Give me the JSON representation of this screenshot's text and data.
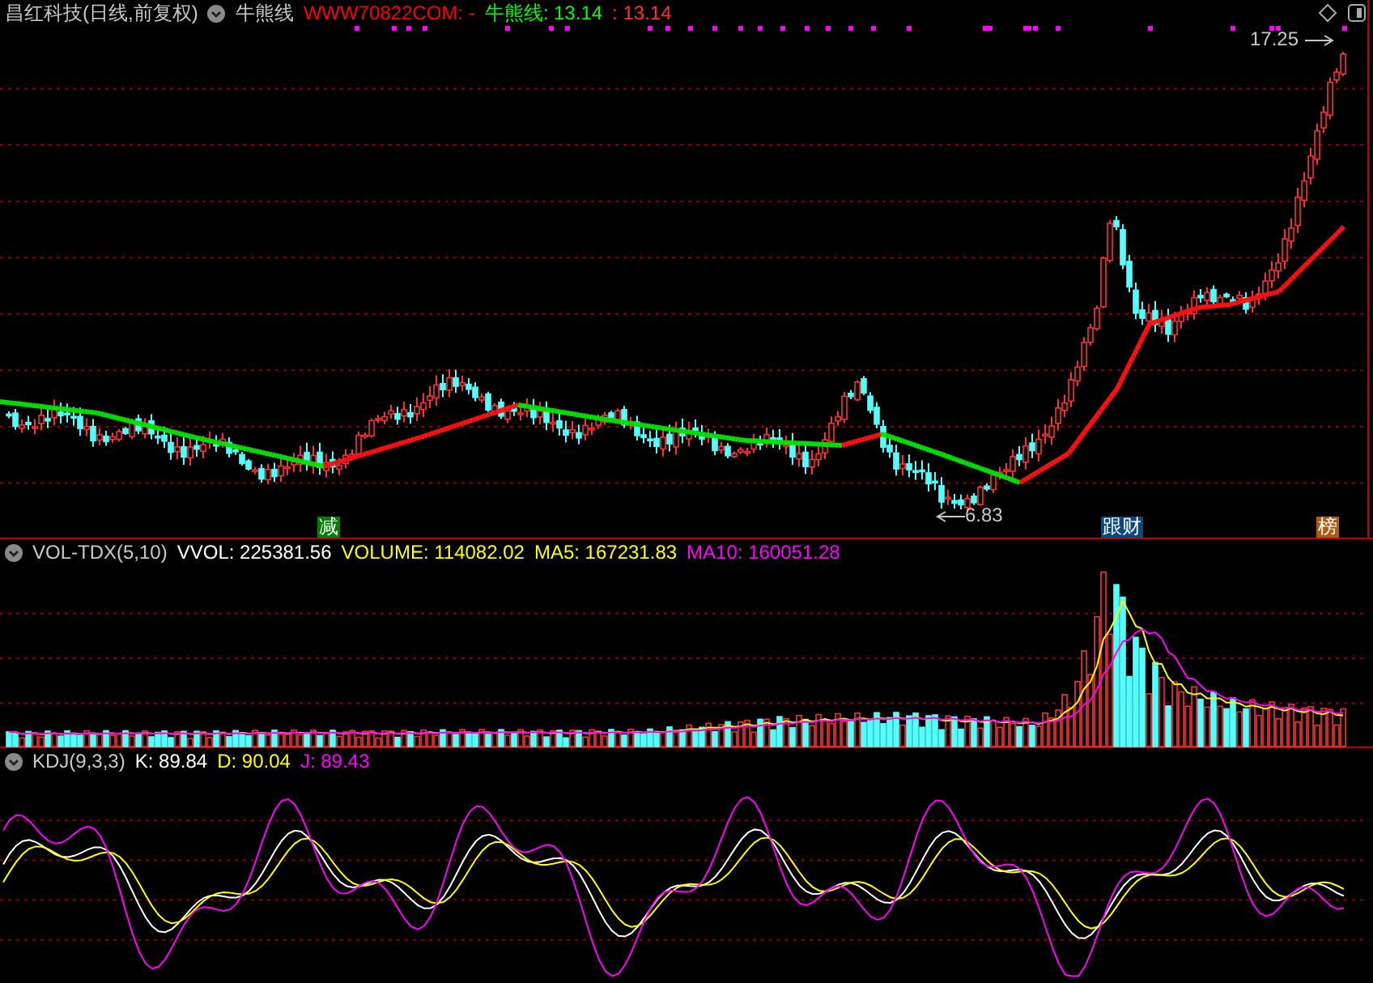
{
  "main": {
    "stock": "昌红科技(日线,前复权)",
    "indicator": "牛熊线",
    "items": [
      {
        "text": "WWW70822COM: -",
        "color": "#ff0000"
      },
      {
        "text": "牛熊线: 13.14",
        "color": "#00ff00"
      },
      {
        "text": ": 13.14",
        "color": "#ff3232"
      }
    ],
    "high_label": "17.25",
    "low_label": "6.83",
    "markers": [
      {
        "text": "减",
        "color": "#008000"
      },
      {
        "text": "跟财",
        "color": "#0a4a7a"
      },
      {
        "text": "榜",
        "color": "#b05a10"
      }
    ]
  },
  "volume": {
    "name": "VOL-TDX(5,10)",
    "items": [
      {
        "text": "VVOL: 225381.56",
        "color": "#ffffff"
      },
      {
        "text": "VOLUME: 114082.02",
        "color": "#ffff00"
      },
      {
        "text": "MA5: 167231.83",
        "color": "#ffff00"
      },
      {
        "text": "MA10: 160051.28",
        "color": "#ff00ff"
      }
    ]
  },
  "kdj": {
    "name": "KDJ(9,3,3)",
    "items": [
      {
        "text": "K: 89.84",
        "color": "#ffffff"
      },
      {
        "text": "D: 90.04",
        "color": "#ffff00"
      },
      {
        "text": "J: 89.43",
        "color": "#ff00ff"
      }
    ]
  }
}
